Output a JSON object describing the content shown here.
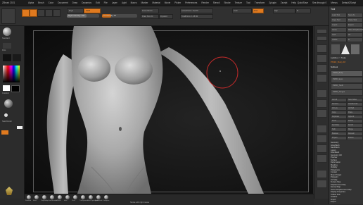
{
  "app": {
    "title": "ZBrush 2021",
    "menu": [
      "Alpha",
      "Brush",
      "Color",
      "Document",
      "Draw",
      "Dynamics",
      "Edit",
      "File",
      "Layer",
      "Light",
      "Macro",
      "Marker",
      "Material",
      "Movie",
      "Picker",
      "Preferences",
      "Render",
      "Stencil",
      "Stroke",
      "Texture",
      "Tool",
      "Transform",
      "Zplugin",
      "Zscript",
      "Help"
    ],
    "status": [
      "QuickSave",
      "See-through 0",
      "Menus",
      "DefaultZScript"
    ]
  },
  "toolbar": {
    "edit_label": "Edit",
    "draw_label": "Draw",
    "move_label": "Move",
    "scale_label": "Scale",
    "rotate_label": "Rotate",
    "focal_shift": "Focal Shift 0",
    "draw_size": "Draw Size 64",
    "dynamic_label": "Dynamic",
    "z_intensity": "Z Intensity 25",
    "rgb_intensity": "Rgb Intensity 100",
    "active_points": "ActivePoints: 94,578",
    "total_points": "TotalPoints: 1.48 Mil",
    "zadd": "Zadd",
    "zsub": "Zsub",
    "mrgb": "Mrgb",
    "rgb": "Rgb",
    "m": "M",
    "zcut": "Zcut"
  },
  "left_shelf": {
    "brush_label": "Standard",
    "stroke_label": "Dots",
    "alpha_label": "Alpha Off",
    "texture_label": "Texture Off",
    "material_label": "MatCap Gray",
    "gradient_label": "Gradient",
    "switch_color": "SwitchColor",
    "alternate": "Alternate"
  },
  "tool_palette": {
    "title": "Tool",
    "buttons": [
      "Load Tool",
      "Save As",
      "Copy Tool",
      "Paste Tool",
      "Import",
      "Export",
      "Clone",
      "Make PolyMesh3D",
      "GoZ",
      "All",
      "Visible",
      "R"
    ],
    "lightbox": "Lightbox > Tools",
    "current_tool": "PM3D_Body 48",
    "subtool_label": "Subtool",
    "subtool_items": [
      "PM3D_Body",
      "PM3D_Eyes",
      "PM3D_Teeth",
      "PM3D_Tongue"
    ],
    "actions": [
      "List All",
      "New Folder",
      "Rename",
      "AutoReorder",
      "All Low",
      "All High",
      "Copy",
      "Paste",
      "Duplicate",
      "Append",
      "Insert",
      "Delete",
      "Del Other",
      "Del All",
      "Split",
      "Merge",
      "Boolean",
      "Remesh",
      "Project",
      "Extract"
    ],
    "sections": [
      "Geometry",
      "ArrayMesh",
      "NanoMesh",
      "Layers",
      "FiberMesh",
      "Geometry HD",
      "Preview",
      "Surface",
      "Deformation",
      "Masking",
      "Visibility",
      "Polygroups",
      "Contact",
      "Morph Target",
      "Polypaint",
      "UV Map",
      "Texture Map",
      "Displacement Map",
      "Normal Map",
      "Vector Displacement Map",
      "Display Properties",
      "Unified Skin",
      "Initialize",
      "Import",
      "Export"
    ]
  },
  "bottom_bar": {
    "brushes": [
      "Standard",
      "Move",
      "ClayBuildup",
      "DamStandard",
      "hPolish",
      "Inflat",
      "Pinch",
      "TrimDynamic",
      "Move Topological",
      "SnakeHook",
      "Transpose"
    ],
    "hint": "Stroke with right mouse"
  },
  "colors": {
    "accent": "#e07a1f",
    "brush_ring": "#c02a2a",
    "background": "#2a2a2a"
  }
}
